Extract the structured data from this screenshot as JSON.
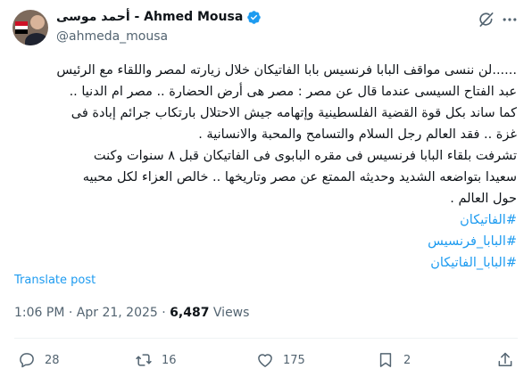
{
  "header": {
    "display_name": "أحمد موسى - Ahmed Mousa",
    "handle": "@ahmeda_mousa",
    "verified": true,
    "top_icons": [
      "grok-icon",
      "more-icon"
    ]
  },
  "tweet": {
    "lines": [
      "......لن ننسى مواقف البابا فرنسيس بابا الفاتيكان  خلال زيارته لمصر واللقاء مع الرئيس",
      "عبد الفتاح السيسى  عندما قال عن مصر  :  مصر هى أرض الحضارة .. مصر ام الدنيا ..",
      "كما ساند بكل قوة القضية الفلسطينية وإتهامه جيش الاحتلال بارتكاب جرائم إبادة فى",
      "غزة .. فقد العالم رجل السلام والتسامح والمحبة والانسانية .",
      "تشرفت بلقاء البابا فرنسيس فى مقره البابوى فى الفاتيكان قبل ٨ سنوات وكنت",
      "سعيدا بتواضعه الشديد وحديثه الممتع عن مصر وتاريخها .. خالص العزاء لكل محبيه",
      "حول العالم ."
    ],
    "hashtags": [
      "#الفاتيكان",
      "#البابا_فرنسيس",
      "#البابا_الفاتيكان"
    ],
    "translate_label": "Translate post",
    "time": "1:06 PM",
    "date": "Apr 21, 2025",
    "separator": "·",
    "views_count": "6,487",
    "views_label": "Views"
  },
  "actions": {
    "replies": "28",
    "reposts": "16",
    "likes": "175",
    "bookmarks": "2"
  },
  "colors": {
    "accent": "#1d9bf0",
    "text": "#0f1419",
    "muted": "#536471",
    "divider": "#eff3f4"
  }
}
